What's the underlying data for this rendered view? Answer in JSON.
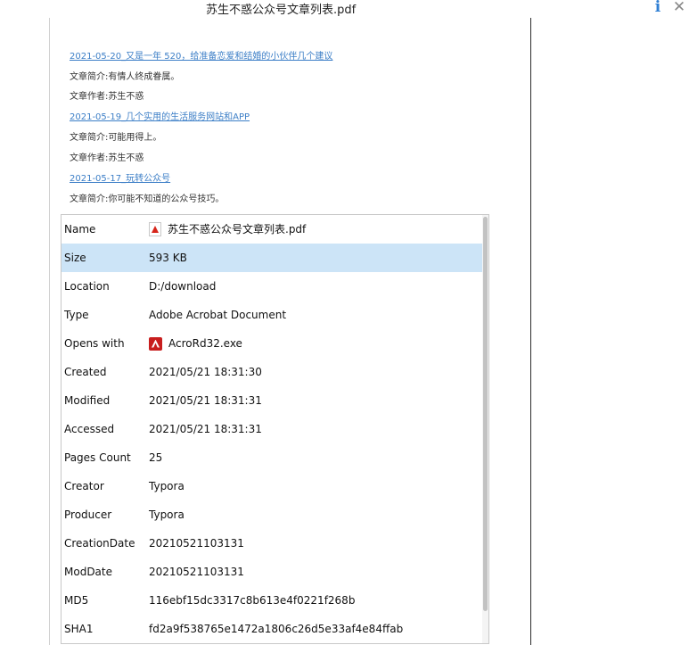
{
  "window": {
    "title": "苏生不惑公众号文章列表.pdf",
    "info_glyph": "i",
    "close_glyph": "✕"
  },
  "document": {
    "lines": [
      {
        "kind": "link",
        "text": "2021-05-20_又是一年 520，给准备恋爱和结婚的小伙伴几个建议"
      },
      {
        "kind": "text",
        "text": "文章简介:有情人终成眷属。"
      },
      {
        "kind": "text",
        "text": "文章作者:苏生不惑"
      },
      {
        "kind": "link",
        "text": "2021-05-19_几个实用的生活服务网站和APP"
      },
      {
        "kind": "text",
        "text": "文章简介:可能用得上。"
      },
      {
        "kind": "text",
        "text": "文章作者:苏生不惑"
      },
      {
        "kind": "link",
        "text": "2021-05-17_玩转公众号"
      },
      {
        "kind": "text",
        "text": "文章简介:你可能不知道的公众号技巧。"
      }
    ]
  },
  "properties": {
    "rows": [
      {
        "label": "Name",
        "value": "苏生不惑公众号文章列表.pdf",
        "icon": "pdf-file-icon",
        "selected": false
      },
      {
        "label": "Size",
        "value": "593 KB",
        "icon": "",
        "selected": true
      },
      {
        "label": "Location",
        "value": "D:/download",
        "icon": "",
        "selected": false
      },
      {
        "label": "Type",
        "value": "Adobe Acrobat Document",
        "icon": "",
        "selected": false
      },
      {
        "label": "Opens with",
        "value": "AcroRd32.exe",
        "icon": "acrobat-reader-icon",
        "selected": false
      },
      {
        "label": "Created",
        "value": "2021/05/21 18:31:30",
        "icon": "",
        "selected": false
      },
      {
        "label": "Modified",
        "value": "2021/05/21 18:31:31",
        "icon": "",
        "selected": false
      },
      {
        "label": "Accessed",
        "value": "2021/05/21 18:31:31",
        "icon": "",
        "selected": false
      },
      {
        "label": "Pages Count",
        "value": "25",
        "icon": "",
        "selected": false
      },
      {
        "label": "Creator",
        "value": "Typora",
        "icon": "",
        "selected": false
      },
      {
        "label": "Producer",
        "value": "Typora",
        "icon": "",
        "selected": false
      },
      {
        "label": "CreationDate",
        "value": "20210521103131",
        "icon": "",
        "selected": false
      },
      {
        "label": "ModDate",
        "value": "20210521103131",
        "icon": "",
        "selected": false
      },
      {
        "label": "MD5",
        "value": "116ebf15dc3317c8b613e4f0221f268b",
        "icon": "",
        "selected": false
      },
      {
        "label": "SHA1",
        "value": "fd2a9f538765e1472a1806c26d5e33af4e84ffab",
        "icon": "",
        "selected": false
      }
    ]
  },
  "colors": {
    "link": "#3d7fc7",
    "selection": "#cce4f7",
    "info_accent": "#2f7fd4"
  }
}
